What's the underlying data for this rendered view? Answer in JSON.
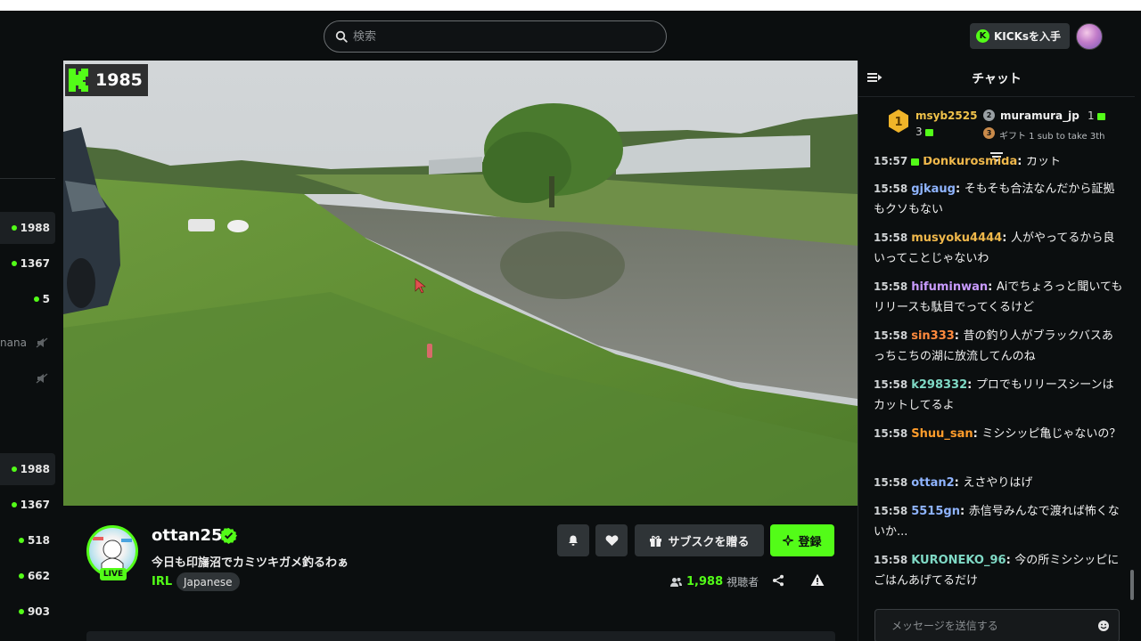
{
  "header": {
    "search_placeholder": "検索",
    "kicks_button": "KICKsを入手",
    "kicks_coin": "K"
  },
  "sidebar": {
    "top_items": [
      {
        "count": "1988",
        "active": true
      },
      {
        "count": "1367"
      },
      {
        "count": "5"
      }
    ],
    "truncated_name": "nana",
    "bottom_items": [
      {
        "count": "1988",
        "active": true
      },
      {
        "count": "1367"
      },
      {
        "count": "518"
      },
      {
        "count": "662"
      },
      {
        "count": "903"
      }
    ]
  },
  "video": {
    "overlay_logo": "K",
    "overlay_count": "1985"
  },
  "stream": {
    "streamer": "ottan25",
    "live_label": "LIVE",
    "title": "今日も印旛沼でカミツキガメ釣るわぁ",
    "category": "IRL",
    "language": "Japanese",
    "gift_sub_label": "サブスクを贈る",
    "subscribe_label": "登録",
    "viewer_count": "1,988",
    "viewer_label": "視聴者"
  },
  "chat": {
    "title": "チャット",
    "leaderboard": {
      "first": {
        "name": "msyb2525",
        "count": "3"
      },
      "second": {
        "rank": "2",
        "name": "muramura_jp",
        "count": "1"
      },
      "third": {
        "rank": "3",
        "text": "ギフト 1 sub to take 3th"
      }
    },
    "partial_message": {
      "time": "15:57",
      "user": "Donkurosmida",
      "text": "カット"
    },
    "messages": [
      {
        "time": "15:58",
        "user": "gjkaug",
        "color": "#8fb4ff",
        "text": "そもそも合法なんだから証拠もクソもない"
      },
      {
        "time": "15:58",
        "user": "musyoku4444",
        "color": "#f0b84b",
        "text": "人がやってるから良いってことじゃないわ"
      },
      {
        "time": "15:58",
        "user": "hifuminwan",
        "color": "#c99bff",
        "text": "Aiでちょろっと聞いてもリリースも駄目でってくるけど"
      },
      {
        "time": "15:58",
        "user": "sin333",
        "color": "#ff8a3d",
        "text": "昔の釣り人がブラックバスあっちこちの湖に放流してんのね"
      },
      {
        "time": "15:58",
        "user": "k298332",
        "color": "#7fd9c5",
        "text": "プロでもリリースシーンはカットしてるよ"
      },
      {
        "time": "15:58",
        "user": "Shuu_san",
        "color": "#ff9c2b",
        "text": "ミシシッピ亀じゃないの？"
      },
      {
        "time": "15:58",
        "user": "ottan2",
        "color": "#8fb4ff",
        "text": "えさやりはげ"
      },
      {
        "time": "15:58",
        "user": "5515gn",
        "color": "#8fb4ff",
        "text": "赤信号みんなで渡れば怖くないか..."
      },
      {
        "time": "15:58",
        "user": "KURONEKO_96",
        "color": "#7fd9c5",
        "text": "今の所ミシシッピにごはんあげてるだけ"
      }
    ],
    "input_placeholder": "メッセージを送信する"
  },
  "colors": {
    "brand": "#53fc18",
    "background": "#0b0e0f",
    "button": "#2f3437"
  },
  "icons": [
    "search-icon",
    "kick-logo-icon",
    "muted-icon",
    "verified-icon",
    "bell-icon",
    "heart-icon",
    "gift-icon",
    "sparkle-icon",
    "users-icon",
    "share-icon",
    "warning-icon",
    "collapse-chat-icon",
    "medal-icon",
    "pin-icon",
    "emoji-icon"
  ]
}
